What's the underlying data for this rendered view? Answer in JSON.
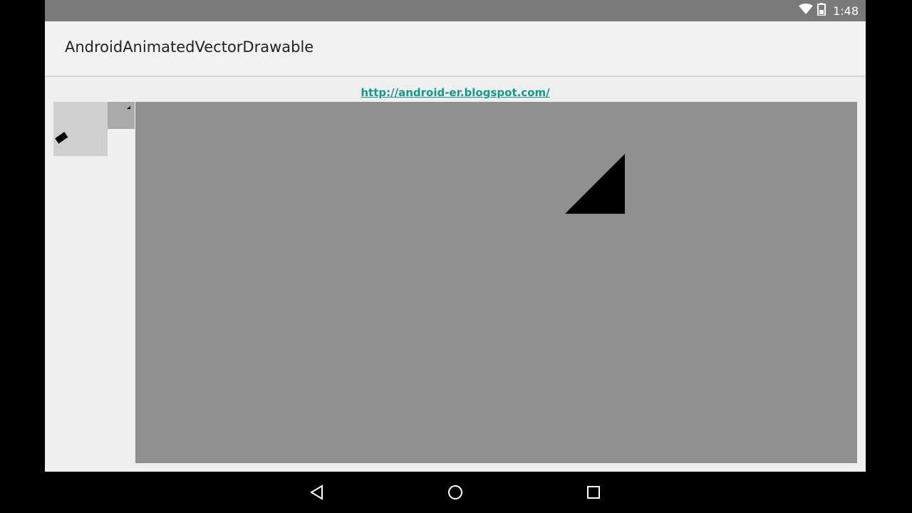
{
  "status_bar": {
    "time": "1:48",
    "icons": [
      "wifi-icon",
      "battery-icon"
    ]
  },
  "app_bar": {
    "title": "AndroidAnimatedVectorDrawable"
  },
  "content": {
    "link_text": "http://android-er.blogspot.com/",
    "images": [
      "animated-vector-small",
      "animated-vector-tiny",
      "animated-vector-large"
    ]
  },
  "nav_bar": {
    "buttons": [
      "back-icon",
      "home-icon",
      "recents-icon"
    ]
  },
  "colors": {
    "status_bar": "#7a7a7a",
    "app_bar": "#f2f2f2",
    "content_bg": "#efefef",
    "link": "#149a8a",
    "image_small_bg": "#cfcfcf",
    "image_tiny_bg": "#a9a9a9",
    "image_large_bg": "#8f8f8f",
    "shape": "#000000"
  }
}
